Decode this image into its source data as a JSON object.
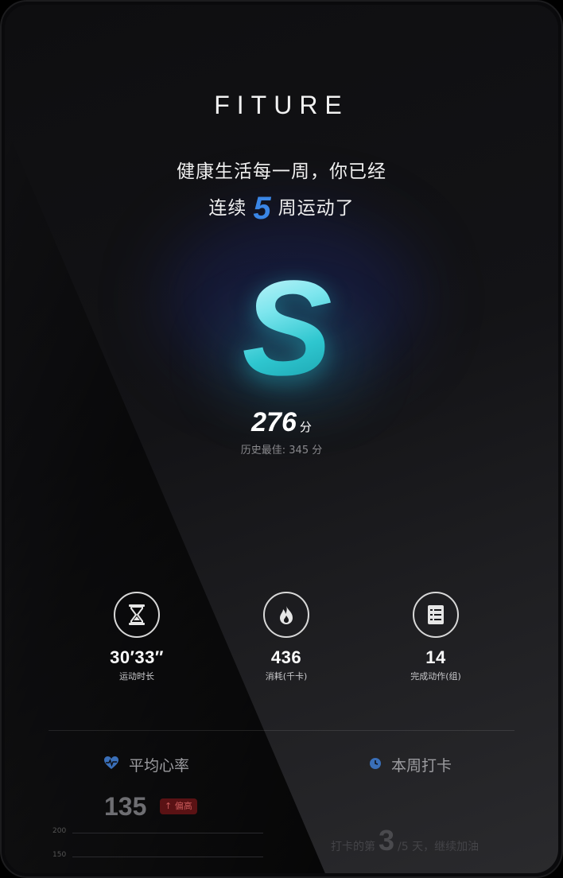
{
  "brand": {
    "logo": "FITURE"
  },
  "headline": {
    "line1": "健康生活每一周，你已经",
    "line2_prefix": "连续",
    "weeks": "5",
    "line2_suffix": "周运动了"
  },
  "grade": {
    "letter": "S"
  },
  "score": {
    "value": "276",
    "unit": "分",
    "best_text": "历史最佳: 345 分"
  },
  "stats": [
    {
      "icon": "hourglass-icon",
      "value": "30′33″",
      "label": "运动时长"
    },
    {
      "icon": "flame-icon",
      "value": "436",
      "label": "消耗(千卡)"
    },
    {
      "icon": "list-icon",
      "value": "14",
      "label": "完成动作(组)"
    }
  ],
  "heart_rate": {
    "title": "平均心率",
    "icon": "heart-icon",
    "value": "135",
    "badge": "↑ 偏高",
    "axis_ticks": [
      "200",
      "150"
    ]
  },
  "weekly_checkin": {
    "title": "本周打卡",
    "icon": "clock-icon",
    "prefix": "打卡的第",
    "day": "3",
    "suffix": "/5 天，继续加油"
  },
  "colors": {
    "accent_blue": "#3a86e6",
    "grade_cyan": "#2ec6cf",
    "badge_red": "#5a1214"
  }
}
